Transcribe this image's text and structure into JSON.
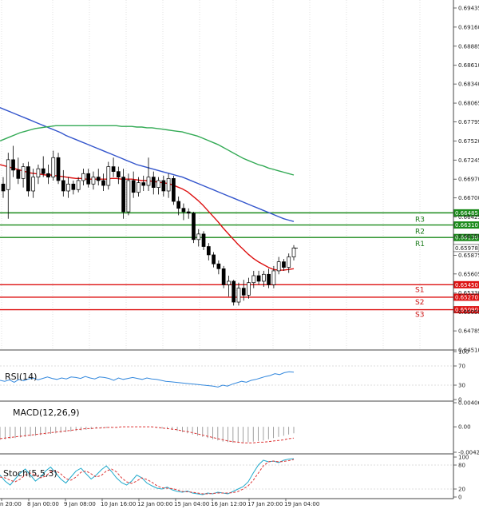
{
  "chart_data": {
    "type": "candlestick",
    "price_axis": {
      "ticks": [
        "0.69435",
        "0.69160",
        "0.68885",
        "0.68610",
        "0.68340",
        "0.68065",
        "0.67795",
        "0.67520",
        "0.67245",
        "0.66970",
        "0.66700",
        "0.66425",
        "0.66150",
        "0.65875",
        "0.65605",
        "0.65330",
        "0.65055",
        "0.64785",
        "0.64510"
      ],
      "ylim": [
        0.6451,
        0.6955
      ]
    },
    "time_axis": {
      "labels": [
        "n 20:00",
        "8 Jan 00:00",
        "9 Jan 08:00",
        "10 Jan 16:00",
        "12 Jan 00:00",
        "15 Jan 04:00",
        "16 Jan 12:00",
        "17 Jan 20:00",
        "19 Jan 04:00"
      ]
    },
    "levels": [
      {
        "name": "R3",
        "value": 0.66485,
        "kind": "resistance",
        "color": "#1a8a1a",
        "tag": "0.66485"
      },
      {
        "name": "R2",
        "value": 0.6631,
        "kind": "resistance",
        "color": "#1a8a1a",
        "tag": "0.66310"
      },
      {
        "name": "R1",
        "value": 0.6613,
        "kind": "resistance",
        "color": "#1a8a1a",
        "tag": "0.66130"
      },
      {
        "name": "S1",
        "value": 0.6545,
        "kind": "support",
        "color": "#dd1111",
        "tag": "0.65450"
      },
      {
        "name": "S2",
        "value": 0.6527,
        "kind": "support",
        "color": "#dd1111",
        "tag": "0.65270"
      },
      {
        "name": "S3",
        "value": 0.6509,
        "kind": "support",
        "color": "#dd1111",
        "tag": "0.65090"
      }
    ],
    "current_price": {
      "value": 0.65978,
      "tag": "0.65978"
    },
    "candles": [
      [
        0.669,
        0.67,
        0.667,
        0.668
      ],
      [
        0.6682,
        0.6735,
        0.664,
        0.6725
      ],
      [
        0.6725,
        0.6745,
        0.67,
        0.671
      ],
      [
        0.671,
        0.6728,
        0.669,
        0.6698
      ],
      [
        0.6698,
        0.672,
        0.6685,
        0.6715
      ],
      [
        0.6715,
        0.6722,
        0.6672,
        0.668
      ],
      [
        0.668,
        0.6712,
        0.667,
        0.67
      ],
      [
        0.67,
        0.6718,
        0.669,
        0.6712
      ],
      [
        0.6712,
        0.673,
        0.67,
        0.6705
      ],
      [
        0.6705,
        0.6718,
        0.669,
        0.67
      ],
      [
        0.67,
        0.6738,
        0.6695,
        0.6728
      ],
      [
        0.6728,
        0.6735,
        0.669,
        0.6695
      ],
      [
        0.6695,
        0.671,
        0.6672,
        0.668
      ],
      [
        0.668,
        0.67,
        0.667,
        0.669
      ],
      [
        0.669,
        0.6695,
        0.6675,
        0.6682
      ],
      [
        0.6682,
        0.67,
        0.6678,
        0.6695
      ],
      [
        0.6695,
        0.6712,
        0.6688,
        0.6705
      ],
      [
        0.6705,
        0.6712,
        0.6685,
        0.669
      ],
      [
        0.669,
        0.6708,
        0.6682,
        0.67
      ],
      [
        0.67,
        0.6712,
        0.6688,
        0.6695
      ],
      [
        0.6695,
        0.6705,
        0.668,
        0.6688
      ],
      [
        0.6688,
        0.6722,
        0.6682,
        0.6715
      ],
      [
        0.6715,
        0.6728,
        0.67,
        0.6708
      ],
      [
        0.6708,
        0.6715,
        0.669,
        0.67
      ],
      [
        0.67,
        0.6712,
        0.664,
        0.665
      ],
      [
        0.665,
        0.6705,
        0.6645,
        0.6695
      ],
      [
        0.6695,
        0.6708,
        0.667,
        0.6678
      ],
      [
        0.6678,
        0.67,
        0.6672,
        0.6692
      ],
      [
        0.6692,
        0.6702,
        0.668,
        0.6688
      ],
      [
        0.6688,
        0.6728,
        0.668,
        0.67
      ],
      [
        0.67,
        0.6708,
        0.6675,
        0.6685
      ],
      [
        0.6685,
        0.67,
        0.6675,
        0.6695
      ],
      [
        0.6695,
        0.6702,
        0.6672,
        0.668
      ],
      [
        0.668,
        0.6705,
        0.667,
        0.6698
      ],
      [
        0.6698,
        0.6702,
        0.666,
        0.6665
      ],
      [
        0.6665,
        0.6672,
        0.6645,
        0.6655
      ],
      [
        0.6655,
        0.6662,
        0.6638,
        0.665
      ],
      [
        0.665,
        0.6655,
        0.664,
        0.6648
      ],
      [
        0.6648,
        0.665,
        0.6605,
        0.661
      ],
      [
        0.661,
        0.6625,
        0.66,
        0.6618
      ],
      [
        0.6618,
        0.6622,
        0.6595,
        0.66
      ],
      [
        0.66,
        0.6605,
        0.658,
        0.6588
      ],
      [
        0.6588,
        0.6592,
        0.657,
        0.6575
      ],
      [
        0.6575,
        0.658,
        0.656,
        0.6568
      ],
      [
        0.6568,
        0.6572,
        0.654,
        0.6545
      ],
      [
        0.6545,
        0.6558,
        0.6528,
        0.655
      ],
      [
        0.655,
        0.6552,
        0.6515,
        0.652
      ],
      [
        0.652,
        0.6548,
        0.6515,
        0.654
      ],
      [
        0.654,
        0.6552,
        0.6522,
        0.653
      ],
      [
        0.653,
        0.6555,
        0.6525,
        0.6548
      ],
      [
        0.6548,
        0.6565,
        0.654,
        0.6558
      ],
      [
        0.6558,
        0.6565,
        0.6545,
        0.655
      ],
      [
        0.655,
        0.6565,
        0.6542,
        0.656
      ],
      [
        0.656,
        0.6568,
        0.654,
        0.6545
      ],
      [
        0.6545,
        0.6572,
        0.654,
        0.6565
      ],
      [
        0.6565,
        0.6585,
        0.656,
        0.6578
      ],
      [
        0.6578,
        0.6582,
        0.6565,
        0.657
      ],
      [
        0.657,
        0.659,
        0.6562,
        0.6585
      ],
      [
        0.6585,
        0.6602,
        0.658,
        0.6598
      ]
    ],
    "moving_averages": [
      {
        "color": "#dd1111",
        "values": [
          0.6718,
          0.6716,
          0.6714,
          0.6712,
          0.671,
          0.6708,
          0.6706,
          0.6705,
          0.6704,
          0.6703,
          0.6703,
          0.6702,
          0.6701,
          0.67,
          0.6699,
          0.6698,
          0.6698,
          0.6697,
          0.6697,
          0.6697,
          0.6697,
          0.6697,
          0.6698,
          0.6698,
          0.6697,
          0.6697,
          0.6697,
          0.6696,
          0.6695,
          0.6695,
          0.6694,
          0.6693,
          0.6692,
          0.6691,
          0.6689,
          0.6686,
          0.6683,
          0.6679,
          0.6673,
          0.6667,
          0.666,
          0.6652,
          0.6644,
          0.6636,
          0.6627,
          0.6619,
          0.6611,
          0.6603,
          0.6596,
          0.6589,
          0.6583,
          0.6578,
          0.6574,
          0.657,
          0.6567,
          0.6566,
          0.6566,
          0.6567,
          0.6568
        ]
      },
      {
        "color": "#3355cc",
        "values": [
          0.68,
          0.6797,
          0.6794,
          0.6791,
          0.6788,
          0.6785,
          0.6782,
          0.6779,
          0.6776,
          0.6773,
          0.677,
          0.6767,
          0.6764,
          0.676,
          0.6757,
          0.6754,
          0.6751,
          0.6748,
          0.6745,
          0.6742,
          0.6739,
          0.6736,
          0.6733,
          0.673,
          0.6727,
          0.6724,
          0.6721,
          0.6718,
          0.6716,
          0.6714,
          0.6712,
          0.671,
          0.6708,
          0.6706,
          0.6704,
          0.6702,
          0.67,
          0.6697,
          0.6694,
          0.6691,
          0.6688,
          0.6685,
          0.6682,
          0.6679,
          0.6676,
          0.6673,
          0.667,
          0.6667,
          0.6664,
          0.6661,
          0.6658,
          0.6655,
          0.6652,
          0.6649,
          0.6646,
          0.6643,
          0.664,
          0.6638,
          0.6636
        ]
      },
      {
        "color": "#33aa55",
        "values": [
          0.6752,
          0.6755,
          0.6758,
          0.6761,
          0.6764,
          0.6766,
          0.6768,
          0.677,
          0.6771,
          0.6772,
          0.6773,
          0.6774,
          0.6774,
          0.6774,
          0.6774,
          0.6774,
          0.6774,
          0.6774,
          0.6774,
          0.6774,
          0.6774,
          0.6774,
          0.6774,
          0.6774,
          0.6773,
          0.6773,
          0.6773,
          0.6772,
          0.6772,
          0.6771,
          0.6771,
          0.677,
          0.6769,
          0.6768,
          0.6767,
          0.6766,
          0.6765,
          0.6763,
          0.6761,
          0.6759,
          0.6756,
          0.6753,
          0.675,
          0.6747,
          0.6743,
          0.6739,
          0.6735,
          0.6731,
          0.6727,
          0.6724,
          0.6721,
          0.6718,
          0.6716,
          0.6713,
          0.6711,
          0.6709,
          0.6707,
          0.6705,
          0.6703
        ]
      }
    ],
    "rsi": {
      "title": "RSI(14)",
      "ticks": [
        "100",
        "70",
        "30",
        "0"
      ],
      "ylim": [
        0,
        100
      ],
      "color": "#3388dd",
      "values": [
        40,
        38,
        41,
        36,
        42,
        39,
        43,
        45,
        41,
        44,
        47,
        44,
        42,
        45,
        43,
        47,
        46,
        44,
        48,
        45,
        43,
        47,
        46,
        44,
        40,
        45,
        42,
        44,
        46,
        44,
        42,
        45,
        43,
        42,
        40,
        38,
        37,
        36,
        35,
        34,
        33,
        32,
        31,
        30,
        29,
        28,
        26,
        30,
        28,
        32,
        35,
        38,
        36,
        40,
        42,
        45,
        48,
        50,
        54,
        52,
        56,
        58,
        57
      ]
    },
    "macd": {
      "title": "MACD(12,26,9)",
      "ticks": [
        "0.004062",
        "0.00",
        "-0.004297"
      ],
      "ylim": [
        -0.004297,
        0.004062
      ],
      "signal_color": "#dd3333",
      "hist_color": "#888888",
      "hist": [
        -0.0022,
        -0.0021,
        -0.002,
        -0.0019,
        -0.0018,
        -0.0017,
        -0.0016,
        -0.0015,
        -0.0014,
        -0.0013,
        -0.0012,
        -0.0011,
        -0.001,
        -0.0009,
        -0.0008,
        -0.0007,
        -0.0006,
        -0.0005,
        -0.0004,
        -0.0003,
        -0.0002,
        -0.0002,
        -0.0001,
        -0.0001,
        0.0,
        0.0,
        0.0,
        0.0,
        0.0,
        0.0,
        -0.0001,
        -0.0002,
        -0.0003,
        -0.0004,
        -0.0005,
        -0.0007,
        -0.0009,
        -0.0011,
        -0.0013,
        -0.0015,
        -0.0017,
        -0.0019,
        -0.0021,
        -0.0023,
        -0.0025,
        -0.0026,
        -0.0027,
        -0.0027,
        -0.0027,
        -0.0026,
        -0.0025,
        -0.0024,
        -0.0023,
        -0.0021,
        -0.0019,
        -0.0017,
        -0.0015,
        -0.0013,
        -0.0011
      ],
      "signal": [
        -0.002,
        -0.0019,
        -0.0018,
        -0.0017,
        -0.0016,
        -0.0015,
        -0.0014,
        -0.0013,
        -0.0012,
        -0.0011,
        -0.001,
        -0.0009,
        -0.0008,
        -0.0007,
        -0.0006,
        -0.0005,
        -0.0004,
        -0.0003,
        -0.0003,
        -0.0002,
        -0.0002,
        -0.0001,
        -0.0001,
        -0.0001,
        0.0,
        0.0,
        0.0,
        0.0,
        0.0,
        0.0,
        0.0,
        -0.0001,
        -0.0002,
        -0.0003,
        -0.0004,
        -0.0005,
        -0.0007,
        -0.0008,
        -0.001,
        -0.0012,
        -0.0014,
        -0.0016,
        -0.0018,
        -0.002,
        -0.0022,
        -0.0024,
        -0.0025,
        -0.0026,
        -0.0027,
        -0.0027,
        -0.0027,
        -0.0026,
        -0.0026,
        -0.0025,
        -0.0024,
        -0.0023,
        -0.0022,
        -0.002,
        -0.0019
      ]
    },
    "stoch": {
      "title": "Stoch(5,5,3)",
      "ticks": [
        "100",
        "80",
        "20",
        "0"
      ],
      "ylim": [
        0,
        100
      ],
      "k_color": "#22aacc",
      "d_color": "#dd3333",
      "k": [
        55,
        40,
        30,
        45,
        60,
        70,
        55,
        40,
        50,
        65,
        75,
        60,
        45,
        35,
        50,
        65,
        72,
        58,
        45,
        55,
        68,
        78,
        64,
        48,
        36,
        30,
        40,
        55,
        48,
        35,
        28,
        22,
        20,
        25,
        18,
        14,
        12,
        15,
        10,
        8,
        6,
        10,
        8,
        12,
        10,
        8,
        14,
        20,
        26,
        38,
        60,
        80,
        92,
        88,
        90,
        86,
        92,
        95,
        96
      ],
      "d": [
        50,
        48,
        42,
        38,
        45,
        55,
        60,
        55,
        48,
        52,
        63,
        66,
        58,
        46,
        42,
        50,
        62,
        65,
        58,
        50,
        54,
        65,
        70,
        63,
        48,
        38,
        34,
        40,
        48,
        44,
        37,
        28,
        23,
        22,
        21,
        18,
        14,
        13,
        12,
        10,
        8,
        8,
        9,
        10,
        10,
        10,
        11,
        14,
        20,
        28,
        42,
        60,
        78,
        88,
        90,
        88,
        89,
        91,
        94
      ]
    }
  }
}
